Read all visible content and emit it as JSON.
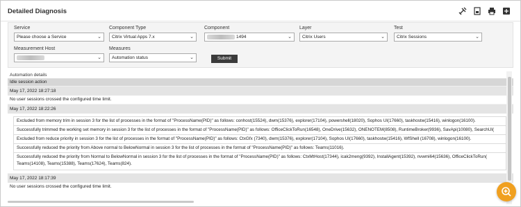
{
  "header": {
    "title": "Detailed Diagnosis"
  },
  "toolbar": {
    "icons": [
      "tools-icon",
      "export-icon",
      "print-icon",
      "export-pdf-icon"
    ]
  },
  "filters": {
    "service": {
      "label": "Service",
      "value": "Please choose a Service"
    },
    "component_type": {
      "label": "Component Type",
      "value": "Citrix Virtual Apps 7.x"
    },
    "component": {
      "label": "Component",
      "value": "1494"
    },
    "layer": {
      "label": "Layer",
      "value": "Citrix Users"
    },
    "test": {
      "label": "Test",
      "value": "Citrix Sessions"
    },
    "measurement_host": {
      "label": "Measurement Host",
      "value": ""
    },
    "measures": {
      "label": "Measures",
      "value": "Automation status"
    },
    "submit_label": "Submit"
  },
  "content": {
    "automation_label": "Automation details",
    "section_title": "Idle session action",
    "groups": [
      {
        "timestamp": "May 17, 2022 18:27:18",
        "message": "No user sessions crossed the configured time limit."
      },
      {
        "timestamp": "May 17, 2022 18:22:26",
        "entries": [
          "Excluded from memory trim in session 3 for the list of processes in the format of \"ProcessName(PID)\" as follows: conhost(15524), dwm(15376), explorer(17104), powershell(18020), Sophos UI(17660), taskhostw(15416), winlogon(16100).",
          "Successfully trimmed the working set memory in session 3 for the list of processes in the format of \"ProcessName(PID)\" as follows: OfficeClickToRun(16548), OneDrive(15632), ONENOTEM(8508), RuntimeBroker(9936), SavApi(10080), SearchUI(",
          "Excluded from reduce priority in session 3 for the list of processes in the format of \"ProcessName(PID)\" as follows: CtxGfx (7340), dwm(15376), explorer(17104), Sophos UI(17660), taskhostw(15416), WfShell (16708), winlogon(16100).",
          "Successfully reduced the priority from Above normal to BelowNormal in session 3 for the list of processes in the format of \"ProcessName(PID)\" as follows: Teams(11016).",
          "Successfully reduced the priority from Normal to BelowNormal in session 3 for the list of processes in the format of \"ProcessName(PID)\" as follows: CtxMtHost(17344), icak2meng(9392), InstallAgent(15392), nvwmi64(15636), OfficeClickToRun( Teams(14108), Teams(15388), Teams(17624), Teams(824)."
        ]
      },
      {
        "timestamp": "May 17, 2022 18:17:39",
        "message": "No user sessions crossed the configured time limit."
      }
    ]
  },
  "colors": {
    "submit": "#3b3b3b",
    "fab": "#f0a020",
    "header_bg": "#d6d6d6"
  }
}
